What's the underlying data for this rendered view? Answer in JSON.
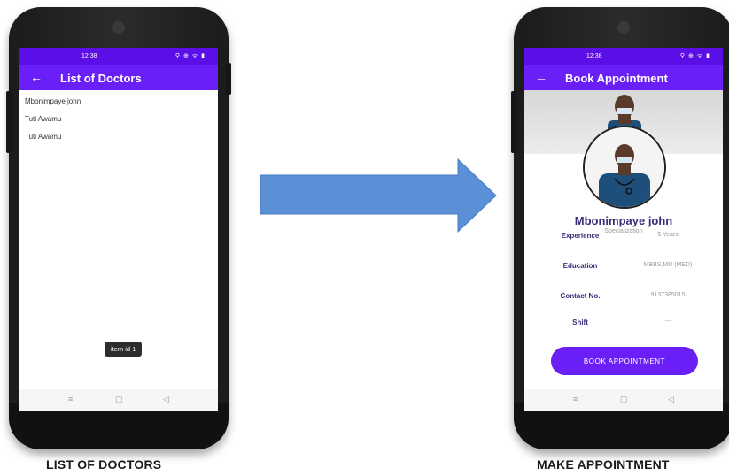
{
  "left_phone": {
    "status_time": "12:38",
    "status_icons": "⚲ ⊕ ᯤ ▮",
    "appbar": {
      "back_icon": "←",
      "title": "List of Doctors"
    },
    "doctors": [
      {
        "name": "Mbonimpaye john"
      },
      {
        "name": "Tuti Awamu"
      },
      {
        "name": "Tuti Awamu"
      }
    ],
    "toast": "item id 1",
    "caption": "LIST OF DOCTORS"
  },
  "right_phone": {
    "status_time": "12:38",
    "status_icons": "⚲ ⊕ ᯤ ▮",
    "appbar": {
      "back_icon": "←",
      "title": "Book Appointment"
    },
    "doctor": {
      "name": "Mbonimpaye john",
      "specialization": "Specialization",
      "details": [
        {
          "label": "Experience",
          "value": "5 Years"
        },
        {
          "label": "Education",
          "value": "MBBS,MD (MED)"
        },
        {
          "label": "Contact No.",
          "value": "9137385015"
        },
        {
          "label": "Shift",
          "value": "---"
        }
      ]
    },
    "book_button": "BOOK APPOINTMENT",
    "caption": "MAKE APPOINTMENT"
  },
  "nav_icons": {
    "menu": "≡",
    "home": "▢",
    "back": "◁"
  },
  "colors": {
    "primary": "#6a1ff6",
    "status": "#5b0fe6",
    "arrow": "#5b8fd6",
    "text_dark": "#3a2d7a"
  }
}
